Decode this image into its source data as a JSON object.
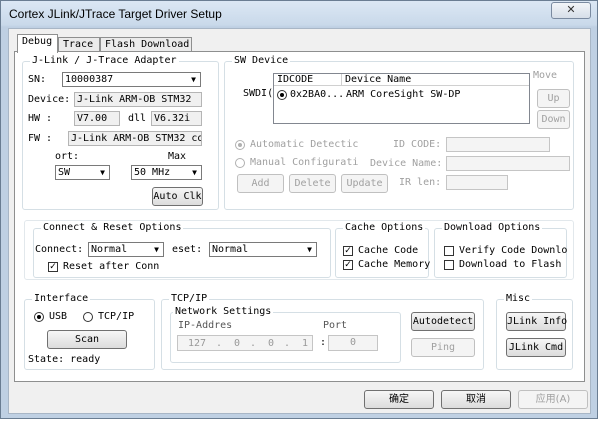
{
  "window": {
    "title": "Cortex JLink/JTrace Target Driver Setup",
    "close_glyph": "✕"
  },
  "tabs": [
    {
      "label": "Debug"
    },
    {
      "label": "Trace"
    },
    {
      "label": "Flash Download"
    }
  ],
  "adapter": {
    "legend": "J-Link / J-Trace Adapter",
    "sn_label": "SN:",
    "sn_value": "10000387",
    "device_label": "Device:",
    "device_value": "J-Link ARM-OB STM32",
    "hw_label": "HW :",
    "hw_value": "V7.00",
    "dll_label": "dll",
    "dll_value": "V6.32i",
    "fw_label": "FW :",
    "fw_value": "J-Link ARM-OB STM32 comp",
    "port_label": "ort:",
    "port_value": "SW",
    "max_label": "Max",
    "max_value": "50 MHz",
    "auto_clk": "Auto Clk"
  },
  "sw_device": {
    "legend": "SW Device",
    "swdi_label": "SWDI(",
    "columns": [
      "IDCODE",
      "Device Name"
    ],
    "row": {
      "idcode": "0x2BA0...",
      "name": "ARM CoreSight SW-DP"
    },
    "move_label": "Move",
    "up": "Up",
    "down": "Down",
    "auto_detect": "Automatic Detectic",
    "manual_config": "Manual Configurati",
    "id_code_label": "ID CODE:",
    "device_name_label": "Device Name:",
    "ir_len_label": "IR len:",
    "add": "Add",
    "delete": "Delete",
    "update": "Update"
  },
  "connect": {
    "legend": "Connect & Reset Options",
    "connect_label": "Connect:",
    "connect_value": "Normal",
    "reset_label": "eset:",
    "reset_value": "Normal",
    "reset_after": "Reset after Conn"
  },
  "cache": {
    "legend": "Cache Options",
    "code": "Cache Code",
    "memory": "Cache Memory"
  },
  "download": {
    "legend": "Download Options",
    "verify": "Verify Code Downlo",
    "to_flash": "Download to Flash"
  },
  "interface": {
    "legend": "Interface",
    "usb": "USB",
    "tcpip": "TCP/IP",
    "scan": "Scan",
    "state": "State: ready"
  },
  "tcpip": {
    "legend": "TCP/IP",
    "network_legend": "Network Settings",
    "ip_label": "IP-Addres",
    "port_label": "Port",
    "ip": [
      "127",
      "0",
      "0",
      "1"
    ],
    "port_value": "0",
    "autodetect": "Autodetect",
    "ping": "Ping"
  },
  "misc": {
    "legend": "Misc",
    "jlink_info": "JLink Info",
    "jlink_cmd": "JLink Cmd"
  },
  "footer": {
    "ok": "确定",
    "cancel": "取消",
    "apply": "应用(A)"
  }
}
